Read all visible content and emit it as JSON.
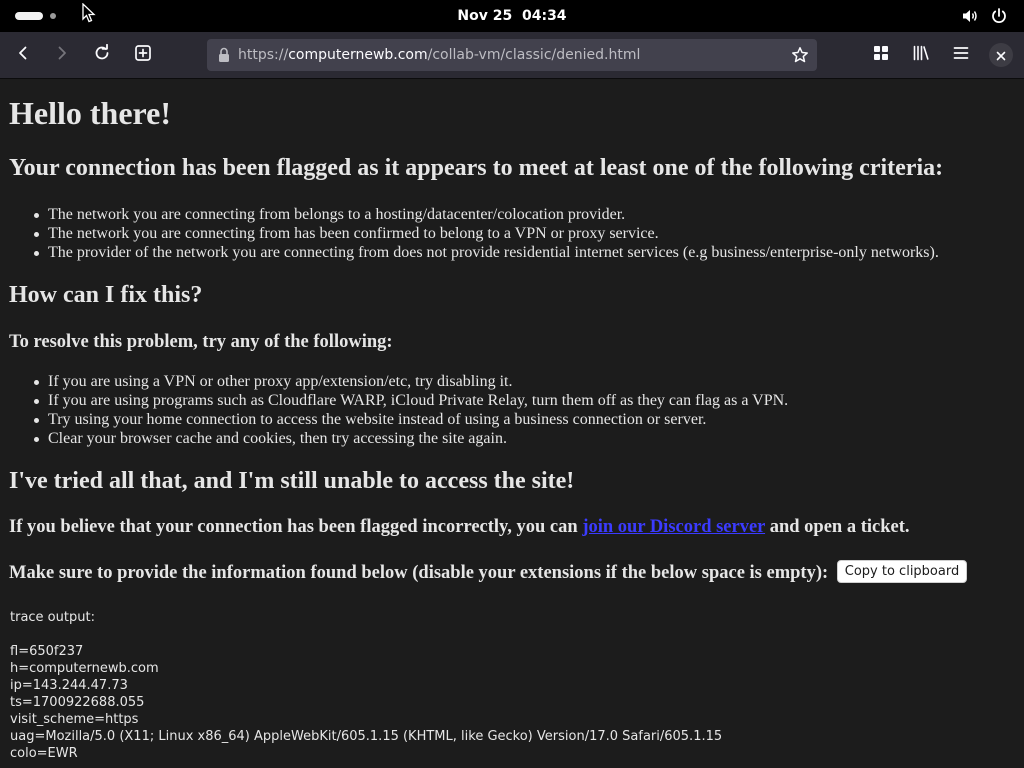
{
  "system": {
    "clock": "Nov 25  04:34",
    "icons": [
      "activities-indicator",
      "pointer-cursor-icon",
      "volume-icon",
      "power-icon"
    ]
  },
  "browser": {
    "url_prefix": "https://",
    "url_host": "computernewb.com",
    "url_path": "/collab-vm/classic/denied.html",
    "icons": [
      "back-arrow-icon",
      "forward-arrow-icon",
      "reload-icon",
      "new-tab-icon",
      "lock-icon",
      "bookmark-star-icon",
      "extensions-grid-icon",
      "library-icon",
      "hamburger-menu-icon",
      "close-icon"
    ]
  },
  "page": {
    "heading": "Hello there!",
    "flagged_heading": "Your connection has been flagged as it appears to meet at least one of the following criteria:",
    "criteria": [
      "The network you are connecting from belongs to a hosting/datacenter/colocation provider.",
      "The network you are connecting from has been confirmed to belong to a VPN or proxy service.",
      "The provider of the network you are connecting from does not provide residential internet services (e.g business/enterprise-only networks)."
    ],
    "fix_heading": "How can I fix this?",
    "resolve_heading": "To resolve this problem, try any of the following:",
    "fixes": [
      "If you are using a VPN or other proxy app/extension/etc, try disabling it.",
      "If you are using programs such as Cloudflare WARP, iCloud Private Relay, turn them off as they can flag as a VPN.",
      "Try using your home connection to access the website instead of using a business connection or server.",
      "Clear your browser cache and cookies, then try accessing the site again."
    ],
    "tried_heading": "I've tried all that, and I'm still unable to access the site!",
    "incorrect_prefix": "If you believe that your connection has been flagged incorrectly, you can",
    "incorrect_link": "join our Discord server",
    "incorrect_suffix": "and open a ticket.",
    "provide_info": "Make sure to provide the information found below (disable your extensions if the below space is empty):",
    "copy_button": "Copy to clipboard",
    "trace_title": "trace output:",
    "trace_lines": [
      "fl=650f237",
      "h=computernewb.com",
      "ip=143.244.47.73",
      "ts=1700922688.055",
      "visit_scheme=https",
      "uag=Mozilla/5.0 (X11; Linux x86_64) AppleWebKit/605.1.15 (KHTML, like Gecko) Version/17.0 Safari/605.1.15",
      "colo=EWR"
    ]
  },
  "colors": {
    "page_bg": "#1c1c1c",
    "toolbar_bg": "#2b2a33",
    "urlbar_bg": "#42414d",
    "link": "#3b3bff",
    "text": "#e6e6e6"
  }
}
